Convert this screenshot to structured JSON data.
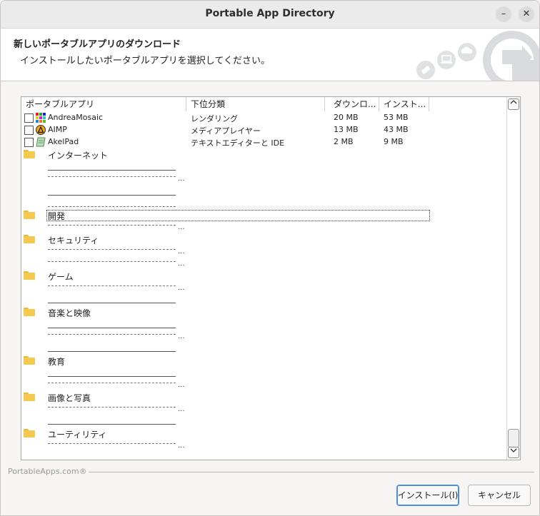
{
  "window": {
    "title": "Portable App Directory",
    "minimize": "–",
    "close": "✕"
  },
  "header": {
    "title": "新しいポータブルアプリのダウンロード",
    "subtitle": "インストールしたいポータブルアプリを選択してください。"
  },
  "columns": {
    "name": "ポータブルアプリ",
    "subcategory": "下位分類",
    "download": "ダウンロ...",
    "install": "インスト..."
  },
  "apps": [
    {
      "name": "AndreaMosaic",
      "subcategory": "レンダリング",
      "download": "20 MB",
      "install": "53 MB",
      "icon": "andreamosaic-icon"
    },
    {
      "name": "AIMP",
      "subcategory": "メディアプレイヤー",
      "download": "13 MB",
      "install": "43 MB",
      "icon": "aimp-icon"
    },
    {
      "name": "AkelPad",
      "subcategory": "テキストエディターと IDE",
      "download": "2 MB",
      "install": "9 MB",
      "icon": "akelpad-icon"
    }
  ],
  "categories": [
    "インターネット",
    "開発",
    "セキュリティ",
    "ゲーム",
    "音楽と映像",
    "教育",
    "画像と写真",
    "ユーティリティ"
  ],
  "ellipsis": "...",
  "scrollbar": {
    "up": "^",
    "down": "v"
  },
  "footer": {
    "brand": "PortableApps.com®",
    "install_button": "インストール(I)",
    "cancel_button": "キャンセル"
  }
}
